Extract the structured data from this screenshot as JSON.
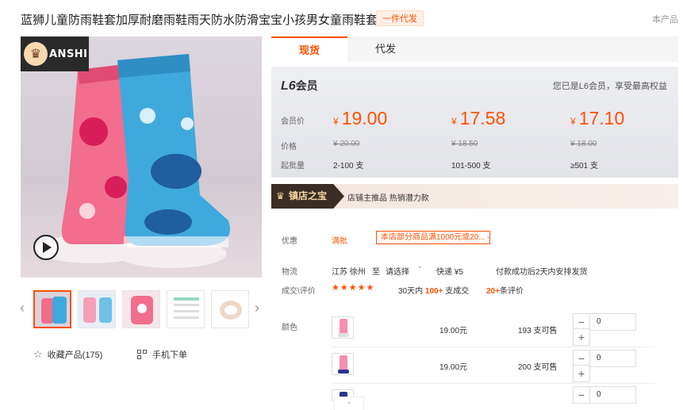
{
  "header": {
    "title": "蓝狮儿童防雨鞋套加厚耐磨雨鞋雨天防水防滑宝宝小孩男女童雨鞋套",
    "tag": "一件代发",
    "top_right": "本产品"
  },
  "gallery": {
    "brand_text": "ANSHI",
    "thumb_prev": "‹",
    "thumb_next": "›",
    "favorite_label": "收藏产品(175)",
    "mobile_order_label": "手机下单"
  },
  "tabs": [
    {
      "label": "现货"
    },
    {
      "label": "代发"
    }
  ],
  "price_box": {
    "level_badge": "L6",
    "level_suffix": "会员",
    "level_note": "您已是L6会员，享受最高权益",
    "row_labels": [
      "会员价",
      "价格",
      "起批量"
    ],
    "currency": "¥",
    "tiers": [
      {
        "member_price": "19.00",
        "original_price": "¥ 20.00",
        "moq": "2-100 支"
      },
      {
        "member_price": "17.58",
        "original_price": "¥ 18.50",
        "moq": "101-500 支"
      },
      {
        "member_price": "17.10",
        "original_price": "¥ 18.00",
        "moq": "≥501 支"
      }
    ]
  },
  "treasure": {
    "badge": "镇店之宝",
    "text": "店铺主推品  热销潜力款"
  },
  "offers": {
    "label": "优惠",
    "link": "満批",
    "coupon": "本店部分商品满1000元或20...",
    "coupon_chevron": "⌄"
  },
  "logistics": {
    "label": "物流",
    "from": "江苏 徐州",
    "to_word": "至",
    "select": "请选择",
    "select_chevron": "⌄",
    "express": "快递  ¥5",
    "note": "付款成功后2天内安排发货"
  },
  "reviews": {
    "label": "成交\\评价",
    "stars": "★★★★★",
    "days": "30天内",
    "sold": "100+",
    "sold_unit": "支成交",
    "count": "20+",
    "count_unit": "条评价"
  },
  "colors": {
    "label": "颜色",
    "rows": [
      {
        "price": "19.00元",
        "stock": "193 支可售",
        "qty": "0"
      },
      {
        "price": "19.00元",
        "stock": "200 支可售",
        "qty": "0"
      },
      {
        "price": "",
        "stock": "",
        "qty": "0"
      }
    ],
    "minus": "−",
    "plus": "+",
    "more_chevron": "⌄"
  },
  "icons": [
    "crown-icon",
    "play-icon",
    "star-outline-icon",
    "qr-code-icon",
    "chevron-left-icon",
    "chevron-right-icon"
  ],
  "colors_theme": {
    "accent": "#ff5000",
    "treasure_dark": "#3a2d24"
  }
}
